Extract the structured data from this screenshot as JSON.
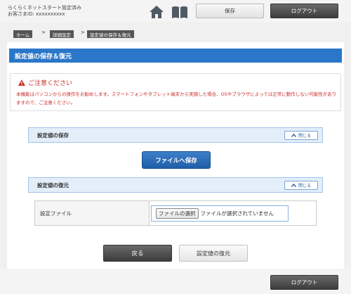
{
  "header": {
    "line1": "らくらくネットスタート設定済み",
    "line2": "お客さまID: xxxxxxxxxx",
    "home_icon": "home-icon",
    "manual_icon": "book-icon",
    "save_label": "保存",
    "logout_label": "ログアウト"
  },
  "breadcrumb": {
    "items": [
      "ホーム",
      "詳細設定",
      "設定値の保存＆復元"
    ],
    "separator": ">"
  },
  "page": {
    "title": "設定値の保存＆復元"
  },
  "caution": {
    "title": "ご注意ください",
    "text": "本機能はパソコンからの操作をお勧めします。スマートフォンやタブレット端末から実施した場合、OSやブラウザによっては正常に動作しない可能性がありますので、ご注意ください。"
  },
  "save_section": {
    "title": "設定値の保存",
    "close_label": "閉じる",
    "file_save_label": "ファイルへ保存"
  },
  "restore_section": {
    "title": "設定値の復元",
    "close_label": "閉じる",
    "file_label": "設定ファイル",
    "choose_label": "ファイルの選択",
    "no_file_text": "ファイルが選択されていません"
  },
  "actions": {
    "back_label": "戻る",
    "restore_label": "設定値の復元"
  },
  "footer": {
    "logout_label": "ログアウト"
  },
  "colors": {
    "accent": "#2a77c9",
    "caution": "#c8302c",
    "section_bg": "#e3eef9",
    "dark_button": "#4a4a4a"
  }
}
